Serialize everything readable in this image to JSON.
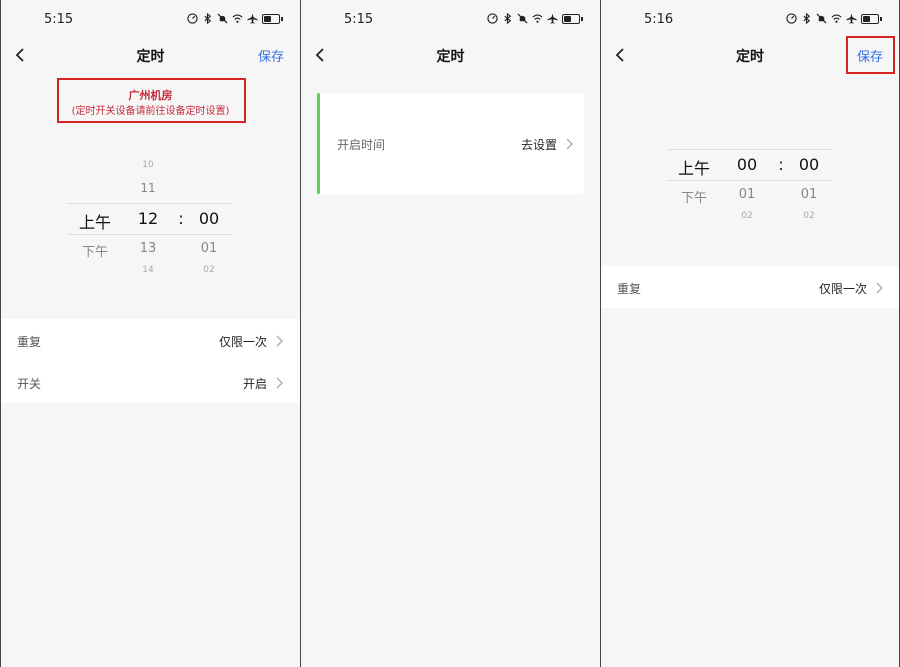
{
  "panels": [
    {
      "status_time": "5:15",
      "title": "定时",
      "save_label": "保存",
      "device_name": "广州机房",
      "device_note": "(定时开关设备请前往设备定时设置)",
      "picker": {
        "period": {
          "above": "",
          "selected": "上午",
          "below": "下午"
        },
        "hour": {
          "above2": "10",
          "above": "11",
          "selected": "12",
          "below": "13",
          "below2": "14"
        },
        "separator": ":",
        "minute": {
          "selected": "00",
          "below": "01",
          "below2": "02"
        }
      },
      "rows": [
        {
          "label": "重复",
          "value": "仅限一次"
        },
        {
          "label": "开关",
          "value": "开启"
        }
      ]
    },
    {
      "status_time": "5:15",
      "title": "定时",
      "row": {
        "label": "开启时间",
        "value": "去设置"
      },
      "accent_color": "#5cd35b"
    },
    {
      "status_time": "5:16",
      "title": "定时",
      "save_label": "保存",
      "picker": {
        "period": {
          "selected": "上午",
          "below": "下午"
        },
        "hour": {
          "selected": "00",
          "below": "01",
          "below2": "02"
        },
        "separator": ":",
        "minute": {
          "selected": "00",
          "below": "01",
          "below2": "02"
        }
      },
      "rows": [
        {
          "label": "重复",
          "value": "仅限一次"
        }
      ]
    }
  ],
  "colors": {
    "link": "#3170e6",
    "highlight_box": "#d52626",
    "device_text": "#c52c3f"
  },
  "icons": [
    "speed-icon",
    "bluetooth-icon",
    "mute-icon",
    "wifi-icon",
    "airplane-icon",
    "battery-icon",
    "back-arrow-icon",
    "chevron-right-icon"
  ]
}
